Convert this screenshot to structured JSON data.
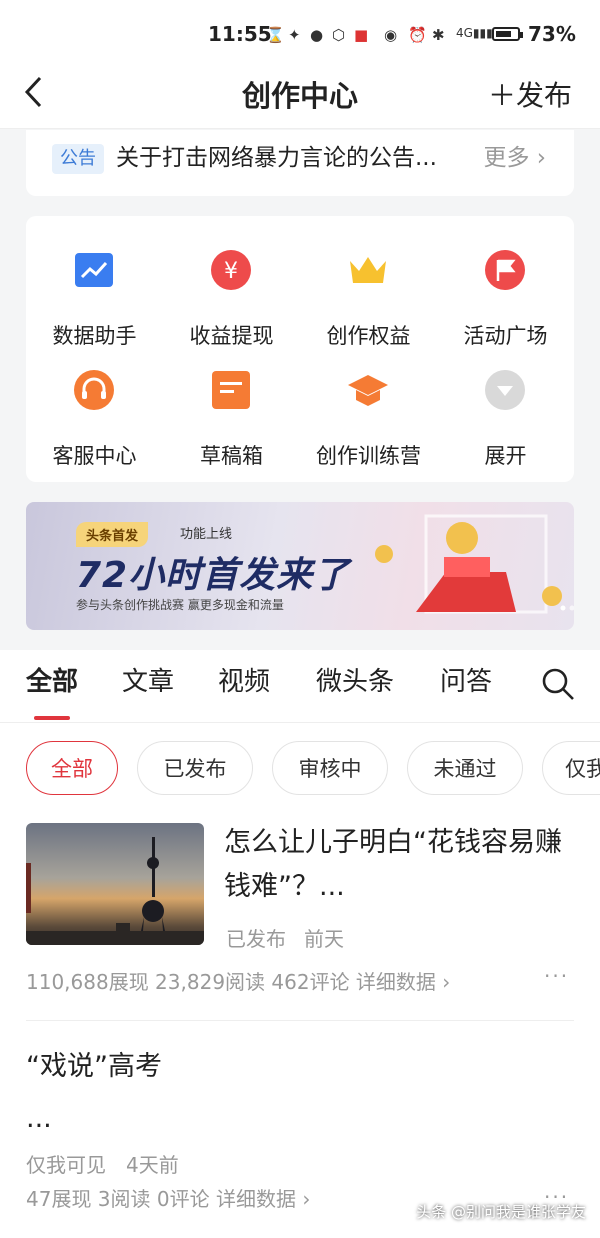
{
  "status_bar": {
    "time": "11:55",
    "battery": "73%",
    "battery_level": 0.73
  },
  "nav": {
    "back": "<",
    "title": "创作中心",
    "publish": "＋发布"
  },
  "notice": {
    "badge": "公告",
    "text": "关于打击网络暴力言论的公告...",
    "more": "更多 ›"
  },
  "grid": [
    {
      "label": "数据助手",
      "icon": "chart-icon",
      "color": "#3a7df0"
    },
    {
      "label": "收益提现",
      "icon": "yuan-icon",
      "color": "#ee4b4b"
    },
    {
      "label": "创作权益",
      "icon": "crown-icon",
      "color": "#f7c12f"
    },
    {
      "label": "活动广场",
      "icon": "flag-icon",
      "color": "#ee4b4b"
    },
    {
      "label": "客服中心",
      "icon": "headset-icon",
      "color": "#f57b34"
    },
    {
      "label": "草稿箱",
      "icon": "draft-icon",
      "color": "#f57b34"
    },
    {
      "label": "创作训练营",
      "icon": "graduation-cap-icon",
      "color": "#f57b34"
    },
    {
      "label": "展开",
      "icon": "expand-icon",
      "color": "#cccccc"
    }
  ],
  "banner": {
    "tag": "头条首发",
    "tag2": "功能上线",
    "title": "72小时首发来了",
    "subtitle": "参与头条创作挑战赛 赢更多现金和流量"
  },
  "tabs": [
    "全部",
    "文章",
    "视频",
    "微头条",
    "问答"
  ],
  "filters": [
    "全部",
    "已发布",
    "审核中",
    "未通过",
    "仅我"
  ],
  "articles": [
    {
      "title": "怎么让儿子明白“花钱容易赚钱难”？...",
      "status": "已发布",
      "time": "前天",
      "stats": "110,688展现  23,829阅读  462评论  详细数据 ›"
    },
    {
      "title": "“戏说”高考",
      "ellipsis": "...",
      "status": "仅我可见",
      "time": "4天前",
      "stats": "47展现  3阅读  0评论  详细数据 ›"
    }
  ],
  "more_dots": "···",
  "watermark": "头条 @别问我是谁张学友"
}
